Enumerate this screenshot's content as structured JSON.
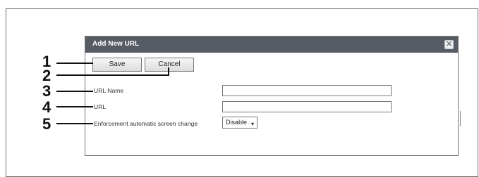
{
  "dialog": {
    "title": "Add New URL",
    "close_icon": "close-icon"
  },
  "buttons": {
    "save": "Save",
    "cancel": "Cancel"
  },
  "fields": {
    "url_name_label": "URL Name",
    "url_name_value": "",
    "url_label": "URL",
    "url_value": "",
    "enforcement_label": "Enforcement automatic screen change",
    "enforcement_value": "Disable"
  },
  "callouts": {
    "n1": "1",
    "n2": "2",
    "n3": "3",
    "n4": "4",
    "n5": "5"
  }
}
